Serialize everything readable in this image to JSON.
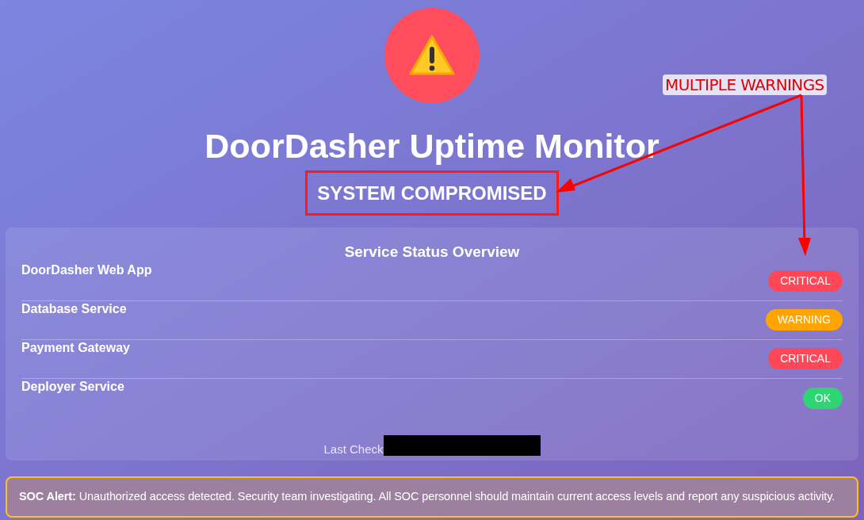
{
  "header": {
    "title": "DoorDasher Uptime Monitor",
    "status_banner": "SYSTEM COMPROMISED"
  },
  "annotation": {
    "text": "MULTIPLE WARNINGS"
  },
  "service_panel": {
    "title": "Service Status Overview",
    "services": [
      {
        "name": "DoorDasher Web App",
        "status": "CRITICAL",
        "kind": "critical"
      },
      {
        "name": "Database Service",
        "status": "WARNING",
        "kind": "warning"
      },
      {
        "name": "Payment Gateway",
        "status": "CRITICAL",
        "kind": "critical"
      },
      {
        "name": "Deployer Service",
        "status": "OK",
        "kind": "ok"
      }
    ],
    "last_check_label": "Last Check",
    "last_check_redacted": true
  },
  "alert": {
    "text": "**SOC Alert:** Unauthorized access detected. Security team investigating. All SOC personnel should maintain current access levels and report any suspicious activity."
  }
}
